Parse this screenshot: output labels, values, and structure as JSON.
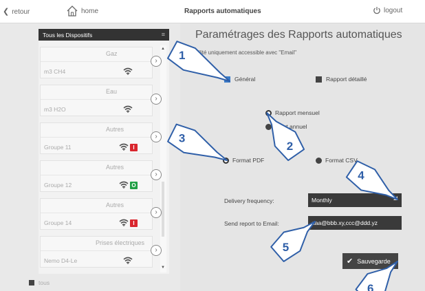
{
  "topbar": {
    "back_label": "retour",
    "home_label": "home",
    "title": "Rapports automatiques",
    "logout_label": "logout"
  },
  "sidebar": {
    "header": "Tous les Dispositifs",
    "devices": [
      {
        "category": "Gaz",
        "name": "m3 CH4",
        "badge": null
      },
      {
        "category": "Eau",
        "name": "m3 H2O",
        "badge": null
      },
      {
        "category": "Autres",
        "name": "Groupe 11",
        "badge": {
          "text": "I",
          "color": "#d9262e"
        }
      },
      {
        "category": "Autres",
        "name": "Groupe 12",
        "badge": {
          "text": "O",
          "color": "#21a046"
        }
      },
      {
        "category": "Autres",
        "name": "Groupe 14",
        "badge": {
          "text": "I",
          "color": "#d9262e"
        }
      },
      {
        "category": "Prises électriques",
        "name": "Nemo D4-Le",
        "badge": null
      }
    ],
    "footer_label": "tous"
  },
  "main": {
    "title": "Paramétrages des Rapports automatiques",
    "note": "bilité uniquement accessible avec \"Email\"",
    "report_type": {
      "general": "Général",
      "detailed": "Rapport détaillé",
      "selected": "general"
    },
    "period": {
      "monthly": "Rapport mensuel",
      "annual": "port annuel",
      "selected": "monthly"
    },
    "format": {
      "pdf": "Format PDF",
      "csv": "Format CSV",
      "selected": "pdf"
    },
    "delivery_label": "Delivery frequency:",
    "delivery_value": "Monthly",
    "email_label": "Send report to Email:",
    "email_value": "aaa@bbb.xy,ccc@ddd.yz",
    "save_label": "Sauvegarde"
  },
  "callouts": [
    "1",
    "2",
    "3",
    "4",
    "5",
    "6"
  ],
  "colors": {
    "accent": "#3a7bc8",
    "callout_fill": "#ffffff",
    "callout_border": "#2f5fa8"
  }
}
